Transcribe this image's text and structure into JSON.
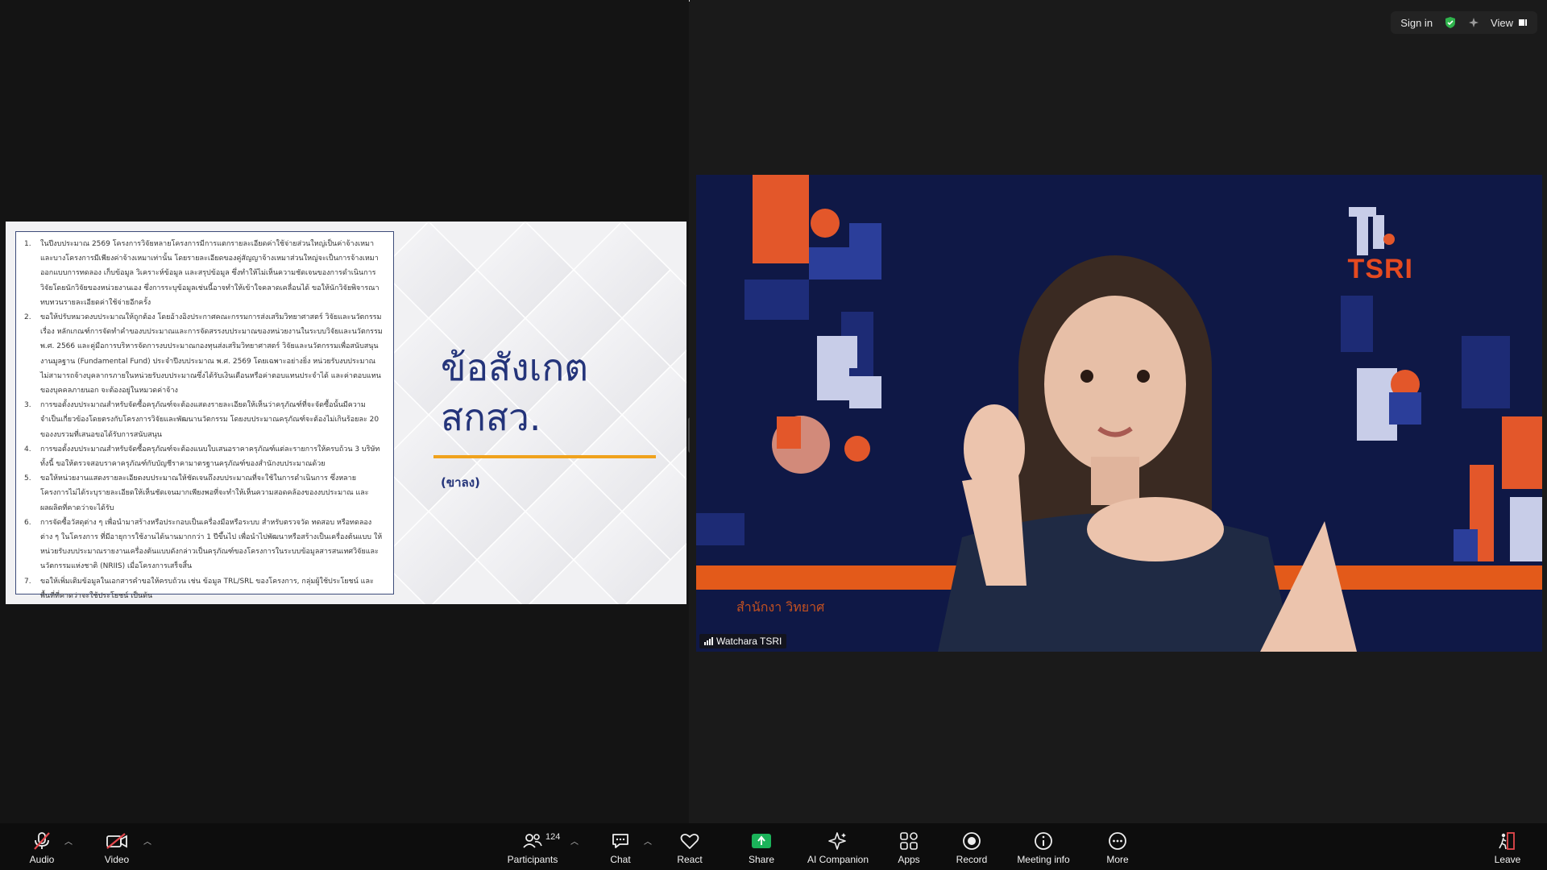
{
  "top_right": {
    "sign_in": "Sign in",
    "view": "View",
    "shield_icon_color": "#2fb34c"
  },
  "slide": {
    "heading_line1": "ข้อสังเกต",
    "heading_line2": "สกสว.",
    "subnote": "(ขาลง)",
    "items": [
      {
        "num": "1.",
        "text": "ในปีงบประมาณ 2569 โครงการวิจัยหลายโครงการมีการแตกรายละเอียดค่าใช้จ่ายส่วนใหญ่เป็นค่าจ้างเหมา และบางโครงการมีเพียงค่าจ้างเหมาเท่านั้น โดยรายละเอียดของคู่สัญญาจ้างเหมาส่วนใหญ่จะเป็นการจ้างเหมาออกแบบการทดลอง เก็บข้อมูล วิเคราะห์ข้อมูล และสรุปข้อมูล ซึ่งทำให้ไม่เห็นความชัดเจนของการดำเนินการวิจัยโดยนักวิจัยของหน่วยงานเอง ซึ่งการระบุข้อมูลเช่นนี้อาจทำให้เข้าใจคลาดเคลื่อนได้ ขอให้นักวิจัยพิจารณาทบทวนรายละเอียดค่าใช้จ่ายอีกครั้ง"
      },
      {
        "num": "2.",
        "text": "ขอให้ปรับหมวดงบประมาณให้ถูกต้อง โดยอ้างอิงประกาศคณะกรรมการส่งเสริมวิทยาศาสตร์ วิจัยและนวัตกรรม เรื่อง หลักเกณฑ์การจัดทำคำของบประมาณและการจัดสรรงบประมาณของหน่วยงานในระบบวิจัยและนวัตกรรม พ.ศ. 2566 และคู่มือการบริหารจัดการงบประมาณกองทุนส่งเสริมวิทยาศาสตร์ วิจัยและนวัตกรรมเพื่อสนับสนุนงานมูลฐาน (Fundamental Fund) ประจำปีงบประมาณ พ.ศ. 2569 โดยเฉพาะอย่างยิ่ง หน่วยรับงบประมาณไม่สามารถจ้างบุคลากรภายในหน่วยรับงบประมาณซึ่งได้รับเงินเดือนหรือค่าตอบแทนประจำได้ และค่าตอบแทนของบุคคลภายนอก จะต้องอยู่ในหมวดค่าจ้าง"
      },
      {
        "num": "3.",
        "text": "การขอตั้งงบประมาณสำหรับจัดซื้อครุภัณฑ์จะต้องแสดงรายละเอียดให้เห็นว่าครุภัณฑ์ที่จะจัดซื้อนั้นมีความจำเป็นเกี่ยวข้องโดยตรงกับโครงการวิจัยและพัฒนานวัตกรรม โดยงบประมาณครุภัณฑ์จะต้องไม่เกินร้อยละ 20 ของงบรวมที่เสนอขอได้รับการสนับสนุน"
      },
      {
        "num": "4.",
        "text": "การขอตั้งงบประมาณสำหรับจัดซื้อครุภัณฑ์จะต้องแนบใบเสนอราคาครุภัณฑ์แต่ละรายการให้ครบถ้วน 3 บริษัท ทั้งนี้ ขอให้ตรวจสอบราคาครุภัณฑ์กับบัญชีราคามาตรฐานครุภัณฑ์ของสำนักงบประมาณด้วย"
      },
      {
        "num": "5.",
        "text": "ขอให้หน่วยงานแสดงรายละเอียดงบประมาณให้ชัดเจนถึงงบประมาณที่จะใช้ในการดำเนินการ ซึ่งหลายโครงการไม่ได้ระบุรายละเอียดให้เห็นชัดเจนมากเพียงพอที่จะทำให้เห็นความสอดคล้องของงบประมาณ และผลผลิตที่คาดว่าจะได้รับ"
      },
      {
        "num": "6.",
        "text": "การจัดซื้อวัสดุต่าง ๆ เพื่อนำมาสร้างหรือประกอบเป็นเครื่องมือหรือระบบ สำหรับตรวจวัด ทดสอบ หรือทดลองต่าง ๆ ในโครงการ ที่มีอายุการใช้งานได้นานมากกว่า 1 ปีขึ้นไป เพื่อนำไปพัฒนาหรือสร้างเป็นเครื่องต้นแบบ ให้หน่วยรับงบประมาณรายงานเครื่องต้นแบบดังกล่าวเป็นครุภัณฑ์ของโครงการในระบบข้อมูลสารสนเทศวิจัยและนวัตกรรมแห่งชาติ (NRIIS) เมื่อโครงการเสร็จสิ้น"
      },
      {
        "num": "7.",
        "text": "ขอให้เพิ่มเติมข้อมูลในเอกสารคำขอให้ครบถ้วน เช่น ข้อมูล TRL/SRL ของโครงการ, กลุ่มผู้ใช้ประโยชน์ และพื้นที่ที่คาดว่าจะใช้ประโยชน์ เป็นต้น"
      }
    ]
  },
  "video": {
    "participant_name": "Watchara TSRI",
    "logo_text": "TSRI",
    "org_watermark": "สำนักงา วิทยาศ"
  },
  "toolbar": {
    "audio": "Audio",
    "video": "Video",
    "participants": "Participants",
    "participants_count": "124",
    "chat": "Chat",
    "react": "React",
    "share": "Share",
    "ai_companion": "AI Companion",
    "apps": "Apps",
    "record": "Record",
    "meeting_info": "Meeting info",
    "more": "More",
    "leave": "Leave",
    "share_color": "#1bb35a",
    "muted_color": "#e5484d"
  }
}
